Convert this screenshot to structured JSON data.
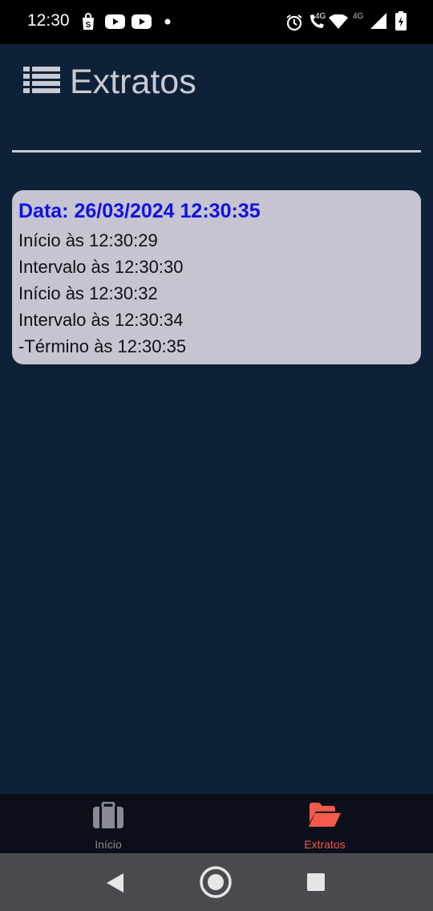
{
  "status_bar": {
    "time": "12:30",
    "network_label_1": "4G",
    "network_label_2": "4G",
    "icons": [
      "shopping-bag-icon",
      "youtube-icon",
      "youtube-icon",
      "dot-icon",
      "alarm-icon",
      "volte-call-icon",
      "wifi-icon",
      "signal-icon",
      "battery-charging-icon"
    ]
  },
  "header": {
    "title": "Extratos",
    "icon": "list-icon"
  },
  "card": {
    "title": "Data: 26/03/2024 12:30:35",
    "entries": [
      "Início às 12:30:29",
      "Intervalo às 12:30:30",
      "Início às 12:30:32",
      "Intervalo às 12:30:34",
      "-Término às 12:30:35"
    ]
  },
  "bottom_nav": {
    "items": [
      {
        "label": "Início",
        "icon": "briefcase-icon",
        "active": false
      },
      {
        "label": "Extratos",
        "icon": "folder-open-icon",
        "active": true
      }
    ]
  },
  "colors": {
    "background": "#0f2138",
    "card_bg": "#c5c4d0",
    "card_title": "#1010e6",
    "active_nav": "#f4594a",
    "inactive_nav": "#8a8a92"
  }
}
